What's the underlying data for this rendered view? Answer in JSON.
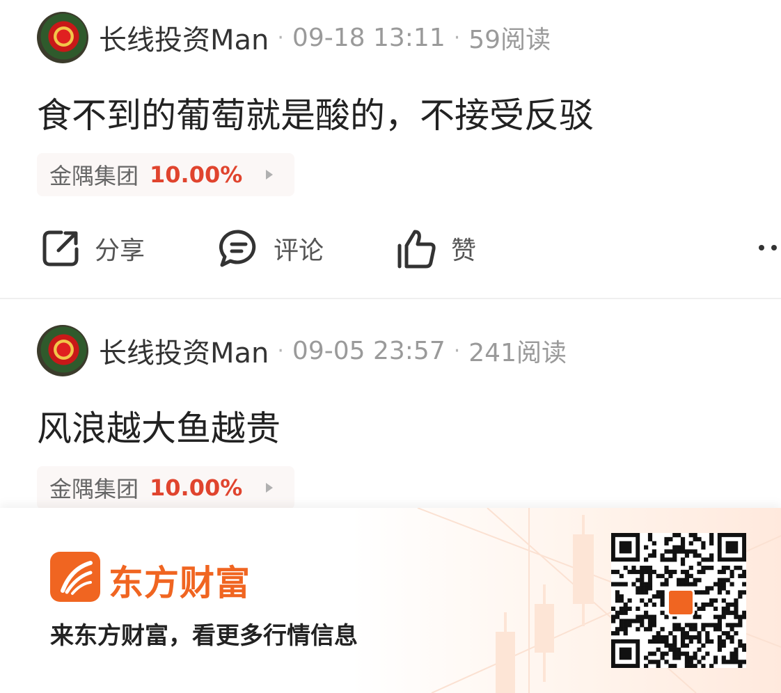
{
  "posts": [
    {
      "username": "长线投资Man",
      "date": "09-18 13:11",
      "reads": "59阅读",
      "content": "食不到的葡萄就是酸的，不接受反驳",
      "stock": {
        "name": "金隅集团",
        "change": "10.00%"
      },
      "actions": {
        "share": "分享",
        "comment": "评论",
        "like": "赞"
      }
    },
    {
      "username": "长线投资Man",
      "date": "09-05 23:57",
      "reads": "241阅读",
      "content": "风浪越大鱼越贵",
      "stock": {
        "name": "金隅集团",
        "change": "10.00%"
      }
    }
  ],
  "footer": {
    "brand": "东方财富",
    "slogan": "来东方财富，看更多行情信息"
  },
  "colors": {
    "accent": "#f06521",
    "stock_up": "#e0442e",
    "tag_bg": "#fbf7f6",
    "meta_text": "#9a9a9a"
  },
  "icons": [
    "share-icon",
    "comment-icon",
    "thumbs-up-icon",
    "more-icon",
    "play-arrow-icon",
    "eastmoney-logo-icon",
    "qr-code"
  ]
}
